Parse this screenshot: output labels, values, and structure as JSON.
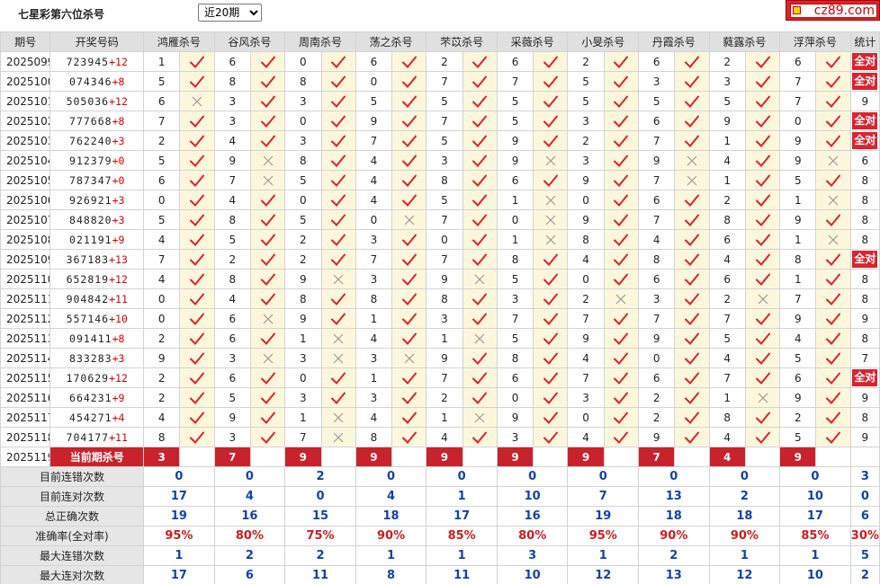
{
  "header": {
    "title": "七星彩第六位杀号",
    "period_select": "近20期"
  },
  "logo": {
    "text": "cz89.com"
  },
  "table": {
    "col_issue": "期号",
    "col_draw": "开奖号码",
    "col_stat": "统计",
    "experts": [
      "鸿雁杀号",
      "谷风杀号",
      "周南杀号",
      "荡之杀号",
      "芣苡杀号",
      "采薇杀号",
      "小旻杀号",
      "丹霞杀号",
      "蕤露杀号",
      "浮萍杀号"
    ],
    "rows": [
      {
        "issue": "2025099",
        "draw": "723945",
        "plus": "+12",
        "kills": [
          "1",
          "6",
          "0",
          "6",
          "2",
          "6",
          "2",
          "6",
          "2",
          "6"
        ],
        "ok": [
          1,
          1,
          1,
          1,
          1,
          1,
          1,
          1,
          1,
          1
        ],
        "stat": "全对"
      },
      {
        "issue": "2025100",
        "draw": "074346",
        "plus": "+8",
        "kills": [
          "5",
          "8",
          "8",
          "0",
          "7",
          "7",
          "5",
          "3",
          "3",
          "7"
        ],
        "ok": [
          1,
          1,
          1,
          1,
          1,
          1,
          1,
          1,
          1,
          1
        ],
        "stat": "全对"
      },
      {
        "issue": "2025101",
        "draw": "505036",
        "plus": "+12",
        "kills": [
          "6",
          "3",
          "3",
          "5",
          "5",
          "5",
          "5",
          "5",
          "5",
          "7"
        ],
        "ok": [
          0,
          1,
          1,
          1,
          1,
          1,
          1,
          1,
          1,
          1
        ],
        "stat": "9"
      },
      {
        "issue": "2025102",
        "draw": "777668",
        "plus": "+8",
        "kills": [
          "7",
          "3",
          "0",
          "9",
          "7",
          "5",
          "3",
          "6",
          "9",
          "0"
        ],
        "ok": [
          1,
          1,
          1,
          1,
          1,
          1,
          1,
          1,
          1,
          1
        ],
        "stat": "全对"
      },
      {
        "issue": "2025103",
        "draw": "762240",
        "plus": "+3",
        "kills": [
          "2",
          "4",
          "3",
          "7",
          "5",
          "9",
          "2",
          "7",
          "1",
          "9"
        ],
        "ok": [
          1,
          1,
          1,
          1,
          1,
          1,
          1,
          1,
          1,
          1
        ],
        "stat": "全对"
      },
      {
        "issue": "2025104",
        "draw": "912379",
        "plus": "+0",
        "kills": [
          "5",
          "9",
          "8",
          "4",
          "3",
          "9",
          "3",
          "9",
          "4",
          "9"
        ],
        "ok": [
          1,
          0,
          1,
          1,
          1,
          0,
          1,
          0,
          1,
          0
        ],
        "stat": "6"
      },
      {
        "issue": "2025105",
        "draw": "787347",
        "plus": "+0",
        "kills": [
          "6",
          "7",
          "5",
          "4",
          "8",
          "6",
          "9",
          "7",
          "1",
          "5"
        ],
        "ok": [
          1,
          0,
          1,
          1,
          1,
          1,
          1,
          0,
          1,
          1
        ],
        "stat": "8"
      },
      {
        "issue": "2025106",
        "draw": "926921",
        "plus": "+3",
        "kills": [
          "0",
          "4",
          "0",
          "4",
          "5",
          "1",
          "0",
          "6",
          "2",
          "1"
        ],
        "ok": [
          1,
          1,
          1,
          1,
          1,
          0,
          1,
          1,
          1,
          0
        ],
        "stat": "8"
      },
      {
        "issue": "2025107",
        "draw": "848820",
        "plus": "+3",
        "kills": [
          "5",
          "8",
          "5",
          "0",
          "7",
          "0",
          "9",
          "7",
          "8",
          "9"
        ],
        "ok": [
          1,
          1,
          1,
          0,
          1,
          0,
          1,
          1,
          1,
          1
        ],
        "stat": "8"
      },
      {
        "issue": "2025108",
        "draw": "021191",
        "plus": "+9",
        "kills": [
          "4",
          "5",
          "2",
          "3",
          "0",
          "1",
          "8",
          "4",
          "6",
          "1"
        ],
        "ok": [
          1,
          1,
          1,
          1,
          1,
          0,
          1,
          1,
          1,
          0
        ],
        "stat": "8"
      },
      {
        "issue": "2025109",
        "draw": "367183",
        "plus": "+13",
        "kills": [
          "7",
          "2",
          "2",
          "7",
          "7",
          "8",
          "4",
          "8",
          "4",
          "8"
        ],
        "ok": [
          1,
          1,
          1,
          1,
          1,
          1,
          1,
          1,
          1,
          1
        ],
        "stat": "全对"
      },
      {
        "issue": "2025110",
        "draw": "652819",
        "plus": "+12",
        "kills": [
          "4",
          "8",
          "9",
          "3",
          "9",
          "5",
          "0",
          "6",
          "6",
          "1"
        ],
        "ok": [
          1,
          1,
          0,
          1,
          0,
          1,
          1,
          1,
          1,
          1
        ],
        "stat": "8"
      },
      {
        "issue": "2025111",
        "draw": "904842",
        "plus": "+11",
        "kills": [
          "0",
          "4",
          "8",
          "8",
          "8",
          "3",
          "2",
          "3",
          "2",
          "7"
        ],
        "ok": [
          1,
          1,
          1,
          1,
          1,
          1,
          0,
          1,
          0,
          1
        ],
        "stat": "8"
      },
      {
        "issue": "2025112",
        "draw": "557146",
        "plus": "+10",
        "kills": [
          "0",
          "6",
          "9",
          "1",
          "3",
          "7",
          "7",
          "7",
          "7",
          "9"
        ],
        "ok": [
          1,
          0,
          1,
          1,
          1,
          1,
          1,
          1,
          1,
          1
        ],
        "stat": "9"
      },
      {
        "issue": "2025113",
        "draw": "091411",
        "plus": "+8",
        "kills": [
          "2",
          "6",
          "1",
          "4",
          "1",
          "5",
          "9",
          "9",
          "5",
          "4"
        ],
        "ok": [
          1,
          1,
          0,
          1,
          0,
          1,
          1,
          1,
          1,
          1
        ],
        "stat": "8"
      },
      {
        "issue": "2025114",
        "draw": "833283",
        "plus": "+3",
        "kills": [
          "9",
          "3",
          "3",
          "3",
          "9",
          "8",
          "4",
          "0",
          "4",
          "5"
        ],
        "ok": [
          1,
          0,
          0,
          0,
          1,
          1,
          1,
          1,
          1,
          1
        ],
        "stat": "7"
      },
      {
        "issue": "2025115",
        "draw": "170629",
        "plus": "+12",
        "kills": [
          "2",
          "6",
          "0",
          "1",
          "7",
          "6",
          "7",
          "6",
          "7",
          "6"
        ],
        "ok": [
          1,
          1,
          1,
          1,
          1,
          1,
          1,
          1,
          1,
          1
        ],
        "stat": "全对"
      },
      {
        "issue": "2025116",
        "draw": "664231",
        "plus": "+9",
        "kills": [
          "2",
          "5",
          "3",
          "3",
          "2",
          "0",
          "3",
          "2",
          "1",
          "9"
        ],
        "ok": [
          1,
          1,
          1,
          1,
          1,
          1,
          1,
          1,
          0,
          1
        ],
        "stat": "9"
      },
      {
        "issue": "2025117",
        "draw": "454271",
        "plus": "+4",
        "kills": [
          "4",
          "9",
          "1",
          "4",
          "1",
          "9",
          "0",
          "2",
          "8",
          "2"
        ],
        "ok": [
          1,
          1,
          0,
          1,
          0,
          1,
          1,
          1,
          1,
          1
        ],
        "stat": "8"
      },
      {
        "issue": "2025118",
        "draw": "704177",
        "plus": "+11",
        "kills": [
          "8",
          "3",
          "7",
          "8",
          "4",
          "3",
          "4",
          "9",
          "4",
          "5"
        ],
        "ok": [
          1,
          1,
          0,
          1,
          1,
          1,
          1,
          1,
          1,
          1
        ],
        "stat": "9"
      }
    ],
    "current": {
      "issue": "2025119",
      "label": "当前期杀号",
      "values": [
        "3",
        "7",
        "9",
        "9",
        "9",
        "9",
        "9",
        "7",
        "4",
        "9"
      ]
    },
    "summary": [
      {
        "label": "目前连错次数",
        "values": [
          "0",
          "0",
          "2",
          "0",
          "0",
          "0",
          "0",
          "0",
          "0",
          "0"
        ],
        "stat": "3",
        "red": false
      },
      {
        "label": "目前连对次数",
        "values": [
          "17",
          "4",
          "0",
          "4",
          "1",
          "10",
          "7",
          "13",
          "2",
          "10"
        ],
        "stat": "0",
        "red": false
      },
      {
        "label": "总正确次数",
        "values": [
          "19",
          "16",
          "15",
          "18",
          "17",
          "16",
          "19",
          "18",
          "18",
          "17"
        ],
        "stat": "6",
        "red": false
      },
      {
        "label": "准确率(全对率)",
        "values": [
          "95%",
          "80%",
          "75%",
          "90%",
          "85%",
          "80%",
          "95%",
          "90%",
          "90%",
          "85%"
        ],
        "stat": "30%",
        "red": true
      },
      {
        "label": "最大连错次数",
        "values": [
          "1",
          "2",
          "2",
          "1",
          "1",
          "3",
          "1",
          "2",
          "1",
          "1"
        ],
        "stat": "5",
        "red": false
      },
      {
        "label": "最大连对次数",
        "values": [
          "17",
          "6",
          "11",
          "8",
          "11",
          "10",
          "12",
          "13",
          "12",
          "10"
        ],
        "stat": "2",
        "red": false
      }
    ]
  },
  "colors": {
    "accent": "#c8232c",
    "check": "#e0202a",
    "cross": "#999999",
    "blue": "#1442a8",
    "markbg": "#fcf7dc"
  }
}
